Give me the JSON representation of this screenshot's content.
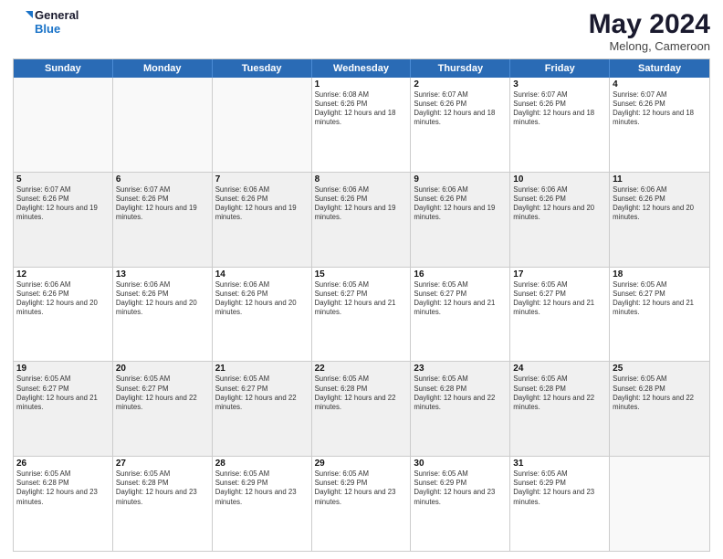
{
  "logo": {
    "line1": "General",
    "line2": "Blue"
  },
  "header": {
    "month": "May 2024",
    "location": "Melong, Cameroon"
  },
  "weekdays": [
    "Sunday",
    "Monday",
    "Tuesday",
    "Wednesday",
    "Thursday",
    "Friday",
    "Saturday"
  ],
  "rows": [
    [
      {
        "day": "",
        "sunrise": "",
        "sunset": "",
        "daylight": "",
        "shaded": false,
        "empty": true
      },
      {
        "day": "",
        "sunrise": "",
        "sunset": "",
        "daylight": "",
        "shaded": false,
        "empty": true
      },
      {
        "day": "",
        "sunrise": "",
        "sunset": "",
        "daylight": "",
        "shaded": false,
        "empty": true
      },
      {
        "day": "1",
        "sunrise": "Sunrise: 6:08 AM",
        "sunset": "Sunset: 6:26 PM",
        "daylight": "Daylight: 12 hours and 18 minutes.",
        "shaded": false,
        "empty": false
      },
      {
        "day": "2",
        "sunrise": "Sunrise: 6:07 AM",
        "sunset": "Sunset: 6:26 PM",
        "daylight": "Daylight: 12 hours and 18 minutes.",
        "shaded": false,
        "empty": false
      },
      {
        "day": "3",
        "sunrise": "Sunrise: 6:07 AM",
        "sunset": "Sunset: 6:26 PM",
        "daylight": "Daylight: 12 hours and 18 minutes.",
        "shaded": false,
        "empty": false
      },
      {
        "day": "4",
        "sunrise": "Sunrise: 6:07 AM",
        "sunset": "Sunset: 6:26 PM",
        "daylight": "Daylight: 12 hours and 18 minutes.",
        "shaded": false,
        "empty": false
      }
    ],
    [
      {
        "day": "5",
        "sunrise": "Sunrise: 6:07 AM",
        "sunset": "Sunset: 6:26 PM",
        "daylight": "Daylight: 12 hours and 19 minutes.",
        "shaded": true,
        "empty": false
      },
      {
        "day": "6",
        "sunrise": "Sunrise: 6:07 AM",
        "sunset": "Sunset: 6:26 PM",
        "daylight": "Daylight: 12 hours and 19 minutes.",
        "shaded": true,
        "empty": false
      },
      {
        "day": "7",
        "sunrise": "Sunrise: 6:06 AM",
        "sunset": "Sunset: 6:26 PM",
        "daylight": "Daylight: 12 hours and 19 minutes.",
        "shaded": true,
        "empty": false
      },
      {
        "day": "8",
        "sunrise": "Sunrise: 6:06 AM",
        "sunset": "Sunset: 6:26 PM",
        "daylight": "Daylight: 12 hours and 19 minutes.",
        "shaded": true,
        "empty": false
      },
      {
        "day": "9",
        "sunrise": "Sunrise: 6:06 AM",
        "sunset": "Sunset: 6:26 PM",
        "daylight": "Daylight: 12 hours and 19 minutes.",
        "shaded": true,
        "empty": false
      },
      {
        "day": "10",
        "sunrise": "Sunrise: 6:06 AM",
        "sunset": "Sunset: 6:26 PM",
        "daylight": "Daylight: 12 hours and 20 minutes.",
        "shaded": true,
        "empty": false
      },
      {
        "day": "11",
        "sunrise": "Sunrise: 6:06 AM",
        "sunset": "Sunset: 6:26 PM",
        "daylight": "Daylight: 12 hours and 20 minutes.",
        "shaded": true,
        "empty": false
      }
    ],
    [
      {
        "day": "12",
        "sunrise": "Sunrise: 6:06 AM",
        "sunset": "Sunset: 6:26 PM",
        "daylight": "Daylight: 12 hours and 20 minutes.",
        "shaded": false,
        "empty": false
      },
      {
        "day": "13",
        "sunrise": "Sunrise: 6:06 AM",
        "sunset": "Sunset: 6:26 PM",
        "daylight": "Daylight: 12 hours and 20 minutes.",
        "shaded": false,
        "empty": false
      },
      {
        "day": "14",
        "sunrise": "Sunrise: 6:06 AM",
        "sunset": "Sunset: 6:26 PM",
        "daylight": "Daylight: 12 hours and 20 minutes.",
        "shaded": false,
        "empty": false
      },
      {
        "day": "15",
        "sunrise": "Sunrise: 6:05 AM",
        "sunset": "Sunset: 6:27 PM",
        "daylight": "Daylight: 12 hours and 21 minutes.",
        "shaded": false,
        "empty": false
      },
      {
        "day": "16",
        "sunrise": "Sunrise: 6:05 AM",
        "sunset": "Sunset: 6:27 PM",
        "daylight": "Daylight: 12 hours and 21 minutes.",
        "shaded": false,
        "empty": false
      },
      {
        "day": "17",
        "sunrise": "Sunrise: 6:05 AM",
        "sunset": "Sunset: 6:27 PM",
        "daylight": "Daylight: 12 hours and 21 minutes.",
        "shaded": false,
        "empty": false
      },
      {
        "day": "18",
        "sunrise": "Sunrise: 6:05 AM",
        "sunset": "Sunset: 6:27 PM",
        "daylight": "Daylight: 12 hours and 21 minutes.",
        "shaded": false,
        "empty": false
      }
    ],
    [
      {
        "day": "19",
        "sunrise": "Sunrise: 6:05 AM",
        "sunset": "Sunset: 6:27 PM",
        "daylight": "Daylight: 12 hours and 21 minutes.",
        "shaded": true,
        "empty": false
      },
      {
        "day": "20",
        "sunrise": "Sunrise: 6:05 AM",
        "sunset": "Sunset: 6:27 PM",
        "daylight": "Daylight: 12 hours and 22 minutes.",
        "shaded": true,
        "empty": false
      },
      {
        "day": "21",
        "sunrise": "Sunrise: 6:05 AM",
        "sunset": "Sunset: 6:27 PM",
        "daylight": "Daylight: 12 hours and 22 minutes.",
        "shaded": true,
        "empty": false
      },
      {
        "day": "22",
        "sunrise": "Sunrise: 6:05 AM",
        "sunset": "Sunset: 6:28 PM",
        "daylight": "Daylight: 12 hours and 22 minutes.",
        "shaded": true,
        "empty": false
      },
      {
        "day": "23",
        "sunrise": "Sunrise: 6:05 AM",
        "sunset": "Sunset: 6:28 PM",
        "daylight": "Daylight: 12 hours and 22 minutes.",
        "shaded": true,
        "empty": false
      },
      {
        "day": "24",
        "sunrise": "Sunrise: 6:05 AM",
        "sunset": "Sunset: 6:28 PM",
        "daylight": "Daylight: 12 hours and 22 minutes.",
        "shaded": true,
        "empty": false
      },
      {
        "day": "25",
        "sunrise": "Sunrise: 6:05 AM",
        "sunset": "Sunset: 6:28 PM",
        "daylight": "Daylight: 12 hours and 22 minutes.",
        "shaded": true,
        "empty": false
      }
    ],
    [
      {
        "day": "26",
        "sunrise": "Sunrise: 6:05 AM",
        "sunset": "Sunset: 6:28 PM",
        "daylight": "Daylight: 12 hours and 23 minutes.",
        "shaded": false,
        "empty": false
      },
      {
        "day": "27",
        "sunrise": "Sunrise: 6:05 AM",
        "sunset": "Sunset: 6:28 PM",
        "daylight": "Daylight: 12 hours and 23 minutes.",
        "shaded": false,
        "empty": false
      },
      {
        "day": "28",
        "sunrise": "Sunrise: 6:05 AM",
        "sunset": "Sunset: 6:29 PM",
        "daylight": "Daylight: 12 hours and 23 minutes.",
        "shaded": false,
        "empty": false
      },
      {
        "day": "29",
        "sunrise": "Sunrise: 6:05 AM",
        "sunset": "Sunset: 6:29 PM",
        "daylight": "Daylight: 12 hours and 23 minutes.",
        "shaded": false,
        "empty": false
      },
      {
        "day": "30",
        "sunrise": "Sunrise: 6:05 AM",
        "sunset": "Sunset: 6:29 PM",
        "daylight": "Daylight: 12 hours and 23 minutes.",
        "shaded": false,
        "empty": false
      },
      {
        "day": "31",
        "sunrise": "Sunrise: 6:05 AM",
        "sunset": "Sunset: 6:29 PM",
        "daylight": "Daylight: 12 hours and 23 minutes.",
        "shaded": false,
        "empty": false
      },
      {
        "day": "",
        "sunrise": "",
        "sunset": "",
        "daylight": "",
        "shaded": false,
        "empty": true
      }
    ]
  ]
}
